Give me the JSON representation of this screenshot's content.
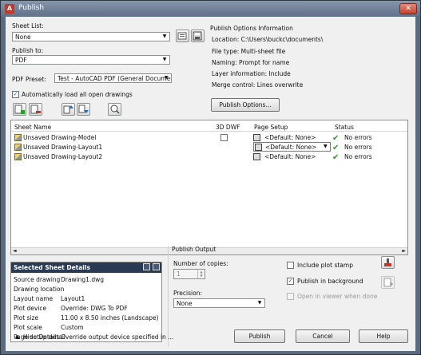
{
  "window": {
    "title": "Publish",
    "close_label": "✕"
  },
  "sheet_list": {
    "label": "Sheet List:",
    "value": "None"
  },
  "publish_to": {
    "label": "Publish to:",
    "value": "PDF"
  },
  "pdf_preset": {
    "label": "PDF Preset:",
    "value": "Test - AutoCAD PDF (General Documenta"
  },
  "auto_load": {
    "label": "Automatically load all open drawings",
    "checked": true
  },
  "options_info": {
    "heading": "Publish Options Information",
    "lines": [
      "Location: C:\\Users\\buckc\\documents\\",
      "File type: Multi-sheet file",
      "Naming: Prompt for name",
      "Layer information: Include",
      "Merge control: Lines overwrite"
    ],
    "button_label": "Publish Options..."
  },
  "grid": {
    "headers": {
      "sheet_name": "Sheet Name",
      "dwf3d": "3D DWF",
      "page_setup": "Page Setup",
      "status": "Status"
    },
    "rows": [
      {
        "name": "Unsaved Drawing-Model",
        "page_setup": "<Default: None>",
        "status": "No errors"
      },
      {
        "name": "Unsaved Drawing-Layout1",
        "page_setup": "<Default: None>",
        "status": "No errors"
      },
      {
        "name": "Unsaved Drawing-Layout2",
        "page_setup": "<Default: None>",
        "status": "No errors"
      }
    ]
  },
  "details": {
    "heading": "Selected Sheet Details",
    "items": [
      {
        "label": "Source drawing",
        "value": "Drawing1.dwg"
      },
      {
        "label": "Drawing location",
        "value": ""
      },
      {
        "label": "Layout name",
        "value": "Layout1"
      },
      {
        "label": "Plot device",
        "value": "Override: DWG To PDF"
      },
      {
        "label": "Plot size",
        "value": "11.00 x 8.50 inches (Landscape)"
      },
      {
        "label": "Plot scale",
        "value": "Custom"
      },
      {
        "label": "Page setup detail",
        "value": "Override output device specified in ..."
      }
    ]
  },
  "publish_output": {
    "heading": "Publish Output",
    "copies_label": "Number of copies:",
    "copies_value": "1",
    "precision_label": "Precision:",
    "precision_value": "None",
    "include_stamp": {
      "label": "Include plot stamp",
      "checked": false
    },
    "background": {
      "label": "Publish in background",
      "checked": true
    },
    "open_viewer": {
      "label": "Open in viewer when done",
      "checked": false
    }
  },
  "footer": {
    "hide_details": "Hide Details",
    "publish": "Publish",
    "cancel": "Cancel",
    "help": "Help"
  },
  "colors": {
    "ok_tick": "#2e9a2e",
    "panel_head": "#2a3a52",
    "title_bar": "#6f8097"
  }
}
